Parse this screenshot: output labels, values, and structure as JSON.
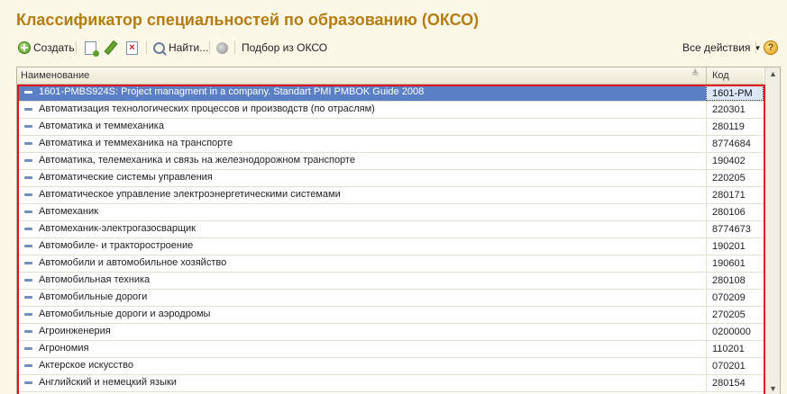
{
  "window": {
    "title": "Классификатор специальностей по образованию (ОКСО)"
  },
  "toolbar": {
    "create_label": "Создать",
    "find_label": "Найти...",
    "pick_label": "Подбор из ОКСО",
    "all_actions_label": "Все действия",
    "help_label": "?"
  },
  "grid": {
    "columns": {
      "name": "Наименование",
      "code": "Код"
    },
    "rows": [
      {
        "name": "1601-PMBS924S: Project managment in a company. Standart PMI PMBOK Guide 2008",
        "code": "1601-PM",
        "selected": true
      },
      {
        "name": "Автоматизация технологических процессов и производств (по отраслям)",
        "code": "220301"
      },
      {
        "name": "Автоматика и теммеханика",
        "code": "280119"
      },
      {
        "name": "Автоматика и теммеханика на транспорте",
        "code": "8774684"
      },
      {
        "name": "Автоматика, телемеханика и связь на железнодорожном транспорте",
        "code": "190402"
      },
      {
        "name": "Автоматические системы управления",
        "code": "220205"
      },
      {
        "name": "Автоматическое управление электроэнергетическими системами",
        "code": "280171"
      },
      {
        "name": "Автомеханик",
        "code": "280106"
      },
      {
        "name": "Автомеханик-электрогазосварщик",
        "code": "8774673"
      },
      {
        "name": "Автомобиле- и тракторостроение",
        "code": "190201"
      },
      {
        "name": "Автомобили и автомобильное хозяйство",
        "code": "190601"
      },
      {
        "name": "Автомобильная техника",
        "code": "280108"
      },
      {
        "name": "Автомобильные дороги",
        "code": "070209"
      },
      {
        "name": "Автомобильные дороги и аэродромы",
        "code": "270205"
      },
      {
        "name": "Агроинженерия",
        "code": "0200000"
      },
      {
        "name": "Агрономия",
        "code": "110201"
      },
      {
        "name": "Актерское искусство",
        "code": "070201"
      },
      {
        "name": "Английский и немецкий языки",
        "code": "280154"
      }
    ]
  }
}
